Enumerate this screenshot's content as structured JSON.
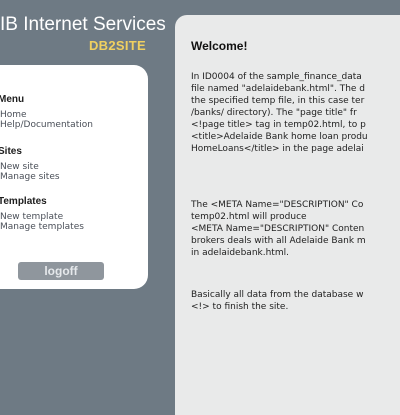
{
  "header": {
    "title": "IB Internet Services",
    "subtitle": "DB2SITE"
  },
  "sidebar": {
    "menu": {
      "heading": "Menu",
      "items": [
        "Home",
        "Help/Documentation"
      ]
    },
    "sites": {
      "heading": "Sites",
      "items": [
        "New site",
        "Manage sites"
      ]
    },
    "templates": {
      "heading": "Templates",
      "items": [
        "New template",
        "Manage templates"
      ]
    },
    "logoff_label": "logoff"
  },
  "content": {
    "welcome": "Welcome!",
    "para1": [
      "In ID0004 of the sample_finance_data",
      "file named \"adelaidebank.html\". The d",
      "the specified temp file, in this case ter",
      "/banks/ directory).  The \"page title\" fr",
      "<!page title> tag in temp02.html, to p",
      "<title>Adelaide Bank home loan produ",
      "HomeLoans</title> in the page adelai"
    ],
    "para2": [
      "The <META Name=\"DESCRIPTION\" Co",
      "temp02.html will produce",
      "<META Name=\"DESCRIPTION\" Conten",
      "brokers deals with all Adelaide Bank m",
      "in adelaidebank.html."
    ],
    "para3": [
      "Basically all data from the database w",
      "<!> to finish the site."
    ]
  }
}
